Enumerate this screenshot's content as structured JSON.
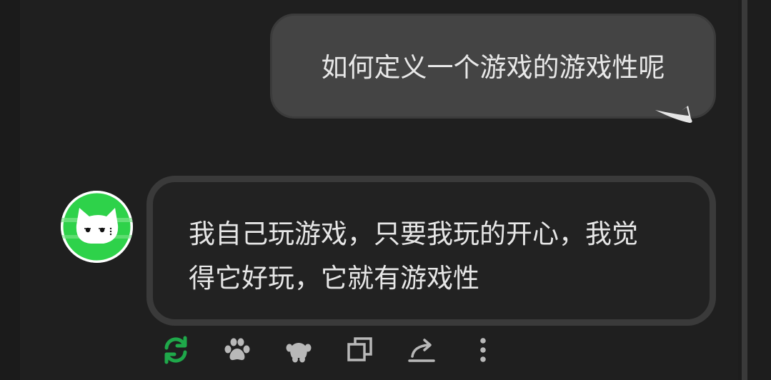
{
  "conversation": {
    "user_message": "如何定义一个游戏的游戏性呢",
    "bot_message_line1": "我自己玩游戏，只要我玩的开心，我觉",
    "bot_message_line2": "得它好玩，它就有游戏性"
  },
  "actions": [
    {
      "icon": "refresh-icon",
      "color": "#1fa84a"
    },
    {
      "icon": "paw-icon",
      "color": "#b8b8b8"
    },
    {
      "icon": "paw-outline-icon",
      "color": "#b8b8b8"
    },
    {
      "icon": "copy-icon",
      "color": "#b8b8b8"
    },
    {
      "icon": "share-icon",
      "color": "#b8b8b8"
    },
    {
      "icon": "more-vertical-icon",
      "color": "#b8b8b8"
    }
  ],
  "colors": {
    "background": "#1f1f1f",
    "user_bubble": "#444444",
    "bot_bubble_border": "#3a3a3a",
    "accent_green": "#1fa84a",
    "avatar_green": "#2ed24a"
  }
}
